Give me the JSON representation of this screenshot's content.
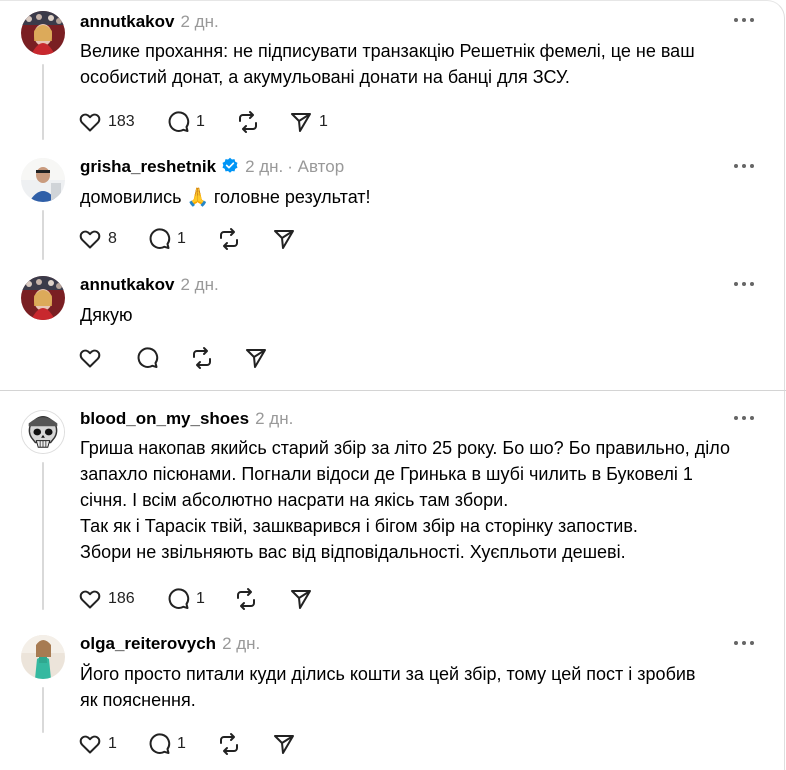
{
  "comments": [
    {
      "username": "annutkakov",
      "time": "2 дн.",
      "lines": [
        "Велике прохання: не підписувати транзакцію Решетнік фемелі, це не ваш",
        "особистий донат, а акумульовані донати на банці для ЗСУ."
      ],
      "likes": "183",
      "replies": "1",
      "reposts": "",
      "shares": "1"
    },
    {
      "username": "grisha_reshetnik",
      "time": "2 дн.",
      "author_label": "Автор",
      "text_before": "домовились ",
      "emoji": "🙏",
      "text_after": " головне результат!",
      "likes": "8",
      "replies": "1",
      "reposts": "",
      "shares": ""
    },
    {
      "username": "annutkakov",
      "time": "2 дн.",
      "lines": [
        "Дякую"
      ],
      "likes": "",
      "replies": "",
      "reposts": "",
      "shares": ""
    },
    {
      "username": "blood_on_my_shoes",
      "time": "2 дн.",
      "lines": [
        "Гриша накопав якийсь старий збір за літо 25 року. Бо шо? Бо правильно, діло",
        "запахло пісюнами. Погнали відоси де Гринька в шубі чилить в Буковелі 1",
        "січня. І всім абсолютно насрати на якісь там збори.",
        "Так як і Тарасік твій, зашкварився і бігом збір на сторінку запостив.",
        "Збори не звільняють вас від відповідальності. Хуєпльоти дешеві."
      ],
      "likes": "186",
      "replies": "1",
      "reposts": "",
      "shares": ""
    },
    {
      "username": "olga_reiterovych",
      "time": "2 дн.",
      "lines": [
        "Його просто питали куди ділись кошти за цей збір, тому цей пост і зробив",
        "як пояснення."
      ],
      "likes": "1",
      "replies": "1",
      "reposts": "",
      "shares": ""
    }
  ],
  "icons": {
    "like": "heart-icon",
    "reply": "comment-icon",
    "repost": "repost-icon",
    "share": "send-icon",
    "more": "more-icon",
    "verified": "verified-badge-icon"
  },
  "colors": {
    "verified": "#0095f6",
    "muted": "#999999",
    "thread_line": "#d9d9d9"
  }
}
